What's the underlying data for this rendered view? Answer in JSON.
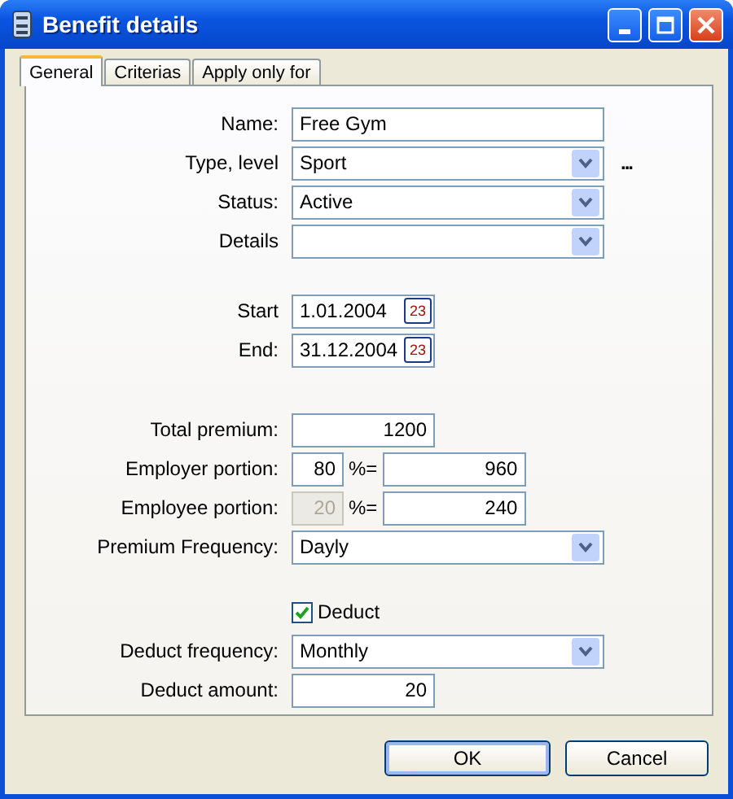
{
  "window": {
    "title": "Benefit details"
  },
  "tabs": [
    {
      "label": "General",
      "selected": true
    },
    {
      "label": "Criterias",
      "selected": false
    },
    {
      "label": "Apply only for",
      "selected": false
    }
  ],
  "form": {
    "sections": [
      {
        "rows": [
          {
            "kind": "text",
            "label": "Name:",
            "value": "Free Gym"
          },
          {
            "kind": "select",
            "label": "Type, level",
            "value": "Sport",
            "more": "..."
          },
          {
            "kind": "select",
            "label": "Status:",
            "value": "Active"
          },
          {
            "kind": "select",
            "label": "Details"
          }
        ]
      },
      {
        "rows": [
          {
            "kind": "date",
            "label": "Start",
            "value": "1.01.2004",
            "calendar": "23"
          },
          {
            "kind": "date",
            "label": "End:",
            "value": "31.12.2004",
            "calendar": "23"
          }
        ]
      },
      {
        "rows": [
          {
            "kind": "amount",
            "label": "Total premium:",
            "value": "1200"
          },
          {
            "kind": "portion",
            "label": "Employer portion:",
            "percent": "80",
            "disabled": false,
            "sign": "%=",
            "amount": "960"
          },
          {
            "kind": "portion",
            "label": "Employee portion:",
            "percent": "20",
            "disabled": true,
            "sign": "%=",
            "amount": "240"
          },
          {
            "kind": "select",
            "label": "Premium Frequency:",
            "value": "Dayly"
          }
        ]
      },
      {
        "rows": [
          {
            "kind": "checkbox",
            "label": "Deduct",
            "checked": true
          },
          {
            "kind": "select",
            "label": "Deduct frequency:",
            "value": "Monthly"
          },
          {
            "kind": "amount",
            "label": "Deduct amount:",
            "value": "20"
          }
        ]
      }
    ]
  },
  "buttons": [
    {
      "label": "OK",
      "default": true
    },
    {
      "label": "Cancel",
      "default": false
    }
  ]
}
